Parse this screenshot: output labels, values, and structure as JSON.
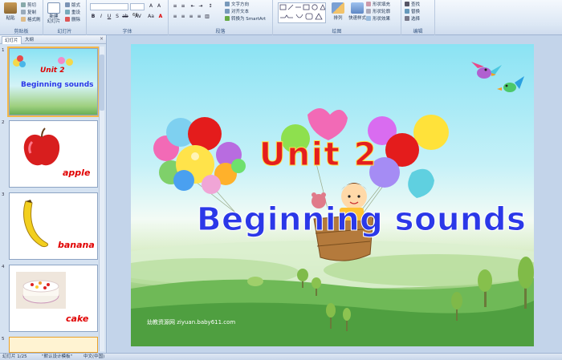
{
  "ribbon": {
    "clipboard": {
      "paste": "粘贴",
      "cut": "剪切",
      "copy": "复制",
      "format_painter": "格式刷",
      "label": "剪贴板"
    },
    "slides": {
      "new_slide": "新建\n幻灯片",
      "layout": "版式",
      "reset": "重设",
      "delete": "删除",
      "label": "幻灯片"
    },
    "font": {
      "name": "",
      "size": "66",
      "label": "字体"
    },
    "paragraph": {
      "direction": "文字方向",
      "align": "对齐文本",
      "smartart": "转换为 SmartArt",
      "label": "段落"
    },
    "drawing": {
      "arrange": "排列",
      "quick_styles": "快速样式",
      "fill": "形状填充",
      "outline": "形状轮廓",
      "effects": "形状效果",
      "label": "绘图"
    },
    "editing": {
      "find": "查找",
      "replace": "替换",
      "select": "选择",
      "label": "编辑"
    }
  },
  "left_panel": {
    "tabs": [
      "幻灯片",
      "大纲"
    ],
    "thumbnails": [
      {
        "num": "1",
        "title1": "Unit 2",
        "title2": "Beginning sounds"
      },
      {
        "num": "2",
        "word": "apple"
      },
      {
        "num": "3",
        "word": "banana"
      },
      {
        "num": "4",
        "word": "cake"
      },
      {
        "num": "5"
      }
    ]
  },
  "slide": {
    "title_line1": "Unit 2",
    "title_line2": "Beginning sounds",
    "watermark": "幼教资源网 ziyuan.baby611.com"
  },
  "status": {
    "slide_count": "幻灯片 1/25",
    "theme": "\"默认设计模板\"",
    "language": "中文(中国)"
  },
  "colors": {
    "accent": "#e41e1e",
    "title_blue": "#2b38e8",
    "ribbon_bg": "#dde8f5"
  }
}
